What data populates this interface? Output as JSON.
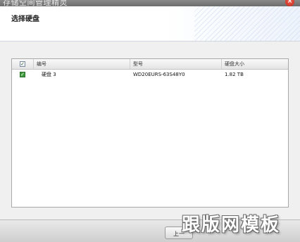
{
  "window": {
    "title": "存储空间管理精灵",
    "close_label": "×"
  },
  "header": {
    "heading": "选择硬盘"
  },
  "table": {
    "columns": [
      "编号",
      "型号",
      "硬盘大小"
    ],
    "header_checkbox": "✓",
    "rows": [
      {
        "checked": true,
        "check_glyph": "✓",
        "id": "硬盘 3",
        "model": "WD20EURS-63S48Y0",
        "size": "1.82 TB"
      }
    ]
  },
  "footer": {
    "prev_label": "上一"
  },
  "watermark": {
    "text": "跟版网模板"
  },
  "colors": {
    "accent_check": "#3e9c3e",
    "close_button": "#d0382c"
  }
}
